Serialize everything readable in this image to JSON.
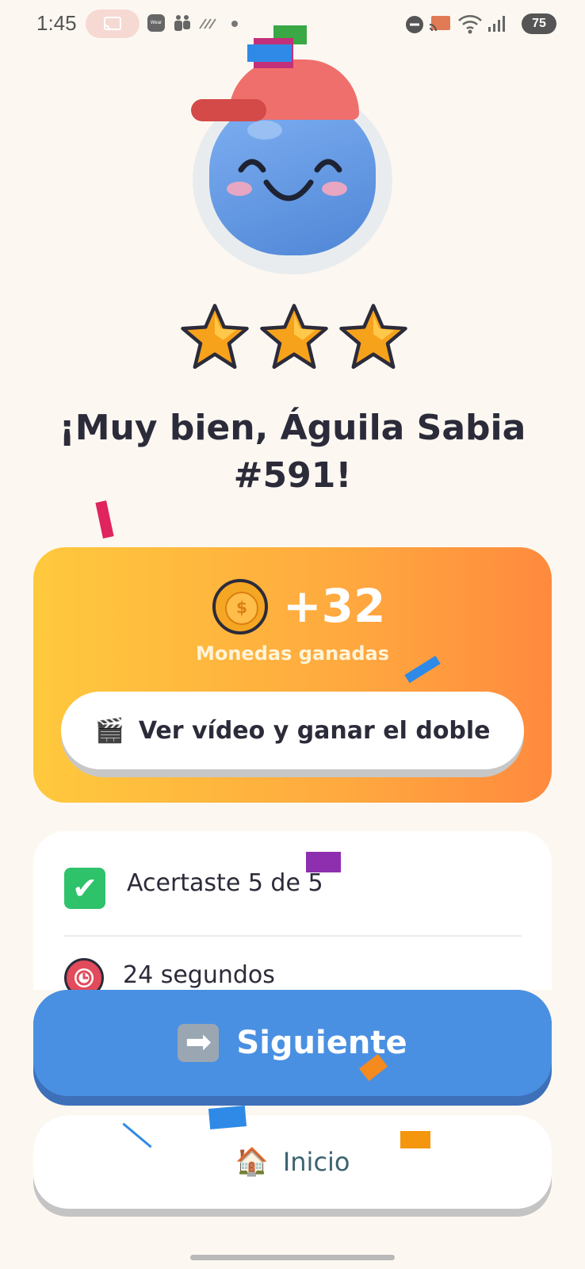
{
  "status_bar": {
    "time": "1:45",
    "wear_label": "Wear",
    "battery": "75",
    "icons": [
      "cast-icon",
      "wear-os-icon",
      "teams-icon",
      "signal-slash-icon",
      "dnd-icon",
      "screencast-icon",
      "wifi-icon",
      "cell-signal-icon",
      "battery-icon"
    ]
  },
  "result": {
    "stars": 3,
    "headline": "¡Muy bien, Águila Sabia #591!"
  },
  "coins": {
    "amount": "+32",
    "caption": "Monedas ganadas",
    "coin_symbol": "$",
    "double_button_label": "Ver vídeo y ganar el doble",
    "double_button_icon": "🎬"
  },
  "stats": {
    "correct_text": "Acertaste 5 de 5",
    "correct_icon": "✔",
    "time_text": "24 segundos"
  },
  "actions": {
    "next_label": "Siguiente",
    "next_icon": "➡",
    "home_label": "Inicio",
    "home_icon": "🏠"
  },
  "colors": {
    "background": "#fcf8f1",
    "primary_button": "#4a90e2",
    "coins_gradient_start": "#ffc93d",
    "coins_gradient_end": "#ff8a3e",
    "text_dark": "#2b2b3a"
  }
}
